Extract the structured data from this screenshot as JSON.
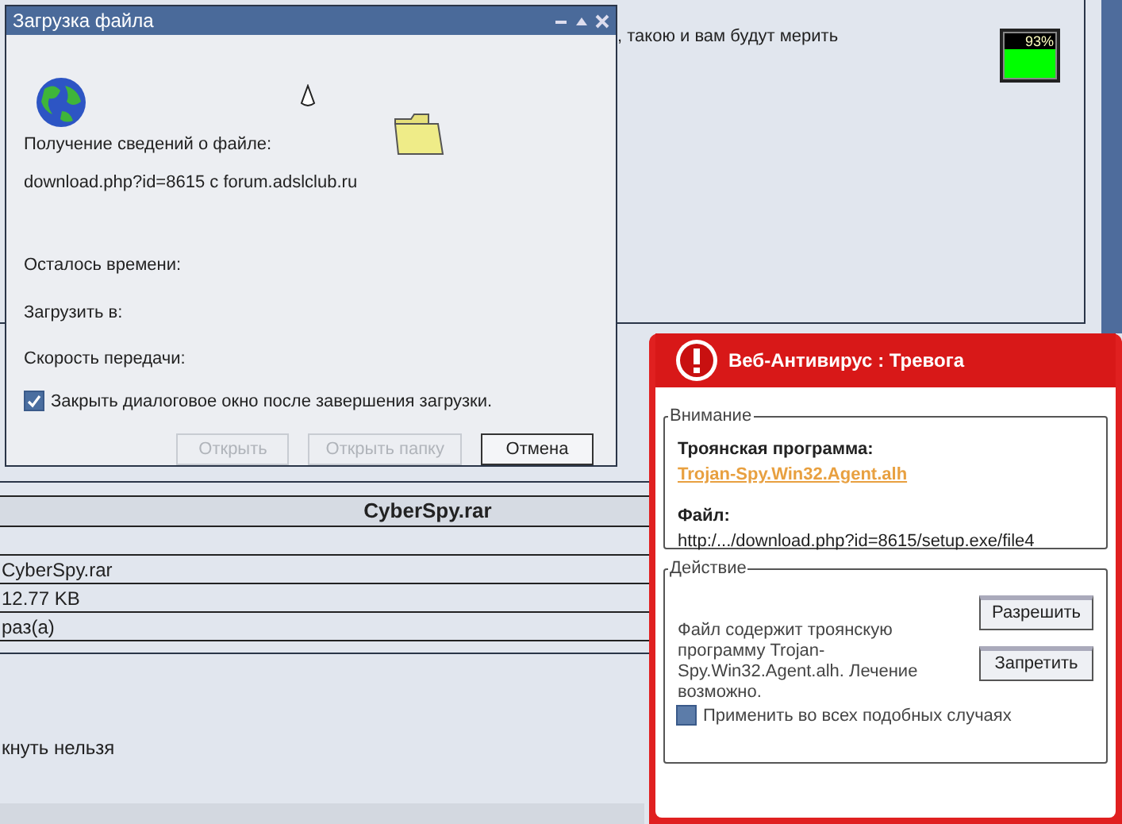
{
  "page": {
    "post_text": ", такою и вам будут мерить",
    "meter": {
      "reading": "93%"
    },
    "table": {
      "header": "CyberSpy.rar",
      "rows": [
        "CyberSpy.rar",
        "12.77 KB",
        "раз(а)"
      ]
    },
    "notice": "кнуть нельзя"
  },
  "download_dialog": {
    "title": "Загрузка файла",
    "status": "Получение сведений о файле:",
    "source": "download.php?id=8615 с forum.adslclub.ru",
    "fields": [
      "Осталось времени:",
      "Загрузить в:",
      "Скорость передачи:"
    ],
    "close_when_done": {
      "label": "Закрыть диалоговое окно после завершения загрузки.",
      "checked": true
    },
    "buttons": [
      {
        "label": "Открыть",
        "disabled": true
      },
      {
        "label": "Открыть папку",
        "disabled": true
      },
      {
        "label": "Отмена",
        "disabled": false
      }
    ]
  },
  "alert": {
    "title": "Веб-Антивирус : Тревога",
    "warning_group": "Внимание",
    "threat_label": "Троянская программа:",
    "threat_name": "Trojan-Spy.Win32.Agent.alh",
    "file_label": "Файл:",
    "file_path": "http:/.../download.php?id=8615/setup.exe/file4",
    "action_group": "Действие",
    "message": "Файл содержит троянскую программу Trojan-Spy.Win32.Agent.alh. Лечение возможно.",
    "buttons": [
      "Разрешить",
      "Запретить"
    ],
    "apply_all": {
      "label": "Применить во всех подобных случаях",
      "checked": false
    }
  }
}
